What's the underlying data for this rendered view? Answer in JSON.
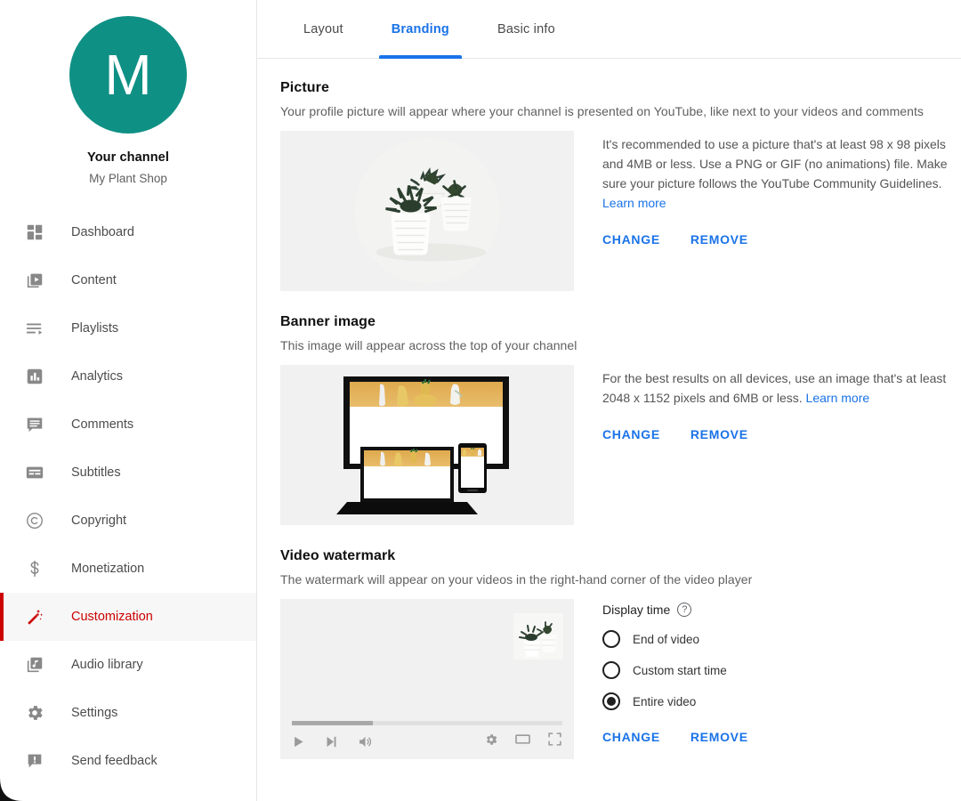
{
  "sidebar": {
    "avatar_letter": "M",
    "avatar_color": "#0f9085",
    "channel_title": "Your channel",
    "channel_name": "My Plant Shop",
    "items": [
      {
        "label": "Dashboard",
        "icon": "dashboard-icon",
        "active": false
      },
      {
        "label": "Content",
        "icon": "content-icon",
        "active": false
      },
      {
        "label": "Playlists",
        "icon": "playlists-icon",
        "active": false
      },
      {
        "label": "Analytics",
        "icon": "analytics-icon",
        "active": false
      },
      {
        "label": "Comments",
        "icon": "comments-icon",
        "active": false
      },
      {
        "label": "Subtitles",
        "icon": "subtitles-icon",
        "active": false
      },
      {
        "label": "Copyright",
        "icon": "copyright-icon",
        "active": false
      },
      {
        "label": "Monetization",
        "icon": "dollar-icon",
        "active": false
      },
      {
        "label": "Customization",
        "icon": "magic-wand-icon",
        "active": true
      },
      {
        "label": "Audio library",
        "icon": "audio-library-icon",
        "active": false
      },
      {
        "label": "Settings",
        "icon": "gear-icon",
        "active": false
      },
      {
        "label": "Send feedback",
        "icon": "feedback-icon",
        "active": false
      }
    ],
    "active_color": "#cc0000"
  },
  "tabs": [
    {
      "label": "Layout",
      "active": false
    },
    {
      "label": "Branding",
      "active": true
    },
    {
      "label": "Basic info",
      "active": false
    }
  ],
  "tab_active_color": "#1a73e8",
  "sections": {
    "picture": {
      "title": "Picture",
      "description": "Your profile picture will appear where your channel is presented on YouTube, like next to your videos and comments",
      "help_text": "It's recommended to use a picture that's at least 98 x 98 pixels and 4MB or less. Use a PNG or GIF (no animations) file. Make sure your picture follows the YouTube Community Guidelines.",
      "learn_more": "Learn more",
      "change_label": "CHANGE",
      "remove_label": "REMOVE"
    },
    "banner": {
      "title": "Banner image",
      "description": "This image will appear across the top of your channel",
      "help_text": "For the best results on all devices, use an image that's at least 2048 x 1152 pixels and 6MB or less.",
      "learn_more": "Learn more",
      "change_label": "CHANGE",
      "remove_label": "REMOVE"
    },
    "watermark": {
      "title": "Video watermark",
      "description": "The watermark will appear on your videos in the right-hand corner of the video player",
      "display_time_label": "Display time",
      "options": [
        {
          "label": "End of video",
          "selected": false
        },
        {
          "label": "Custom start time",
          "selected": false
        },
        {
          "label": "Entire video",
          "selected": true
        }
      ],
      "change_label": "CHANGE",
      "remove_label": "REMOVE",
      "progress_percent": 30
    }
  }
}
